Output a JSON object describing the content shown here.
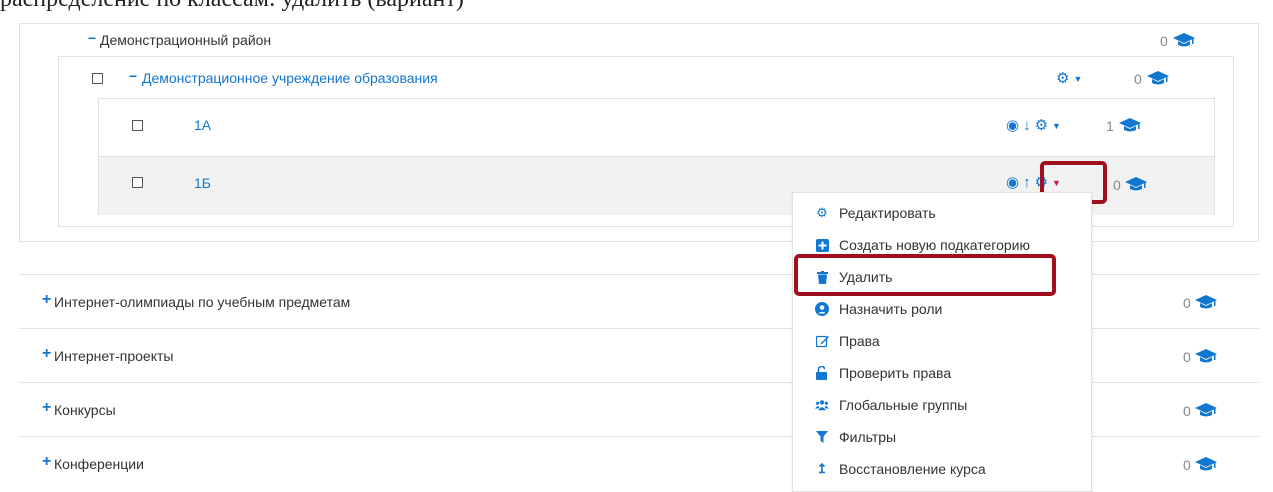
{
  "header": {
    "partial_text": "распределение по классам: удалить (вариант)"
  },
  "tree": {
    "district": {
      "toggle": "−",
      "label": "Демонстрационный район",
      "count": "0"
    },
    "institution": {
      "toggle": "−",
      "label": "Демонстрационное учреждение образования",
      "count": "0"
    },
    "classes": [
      {
        "label": "1А",
        "count": "1"
      },
      {
        "label": "1Б",
        "count": "0"
      }
    ]
  },
  "categories": [
    {
      "toggle": "+",
      "label": "Интернет-олимпиады по учебным предметам",
      "count": "0"
    },
    {
      "toggle": "+",
      "label": "Интернет-проекты",
      "count": "0"
    },
    {
      "toggle": "+",
      "label": "Конкурсы",
      "count": "0"
    },
    {
      "toggle": "+",
      "label": "Конференции",
      "count": "0"
    }
  ],
  "menu": {
    "items": [
      {
        "label": "Редактировать",
        "icon": "gear-icon"
      },
      {
        "label": "Создать новую подкатегорию",
        "icon": "plus-square-icon"
      },
      {
        "label": "Удалить",
        "icon": "trash-icon"
      },
      {
        "label": "Назначить роли",
        "icon": "user-circle-icon"
      },
      {
        "label": "Права",
        "icon": "edit-icon"
      },
      {
        "label": "Проверить права",
        "icon": "unlock-icon"
      },
      {
        "label": "Глобальные группы",
        "icon": "users-icon"
      },
      {
        "label": "Фильтры",
        "icon": "filter-icon"
      },
      {
        "label": "Восстановление курса",
        "icon": "level-up-icon"
      }
    ]
  },
  "colors": {
    "accent": "#1177d1",
    "highlight": "#a10f1e",
    "row_selected": "#f2f2f2"
  }
}
